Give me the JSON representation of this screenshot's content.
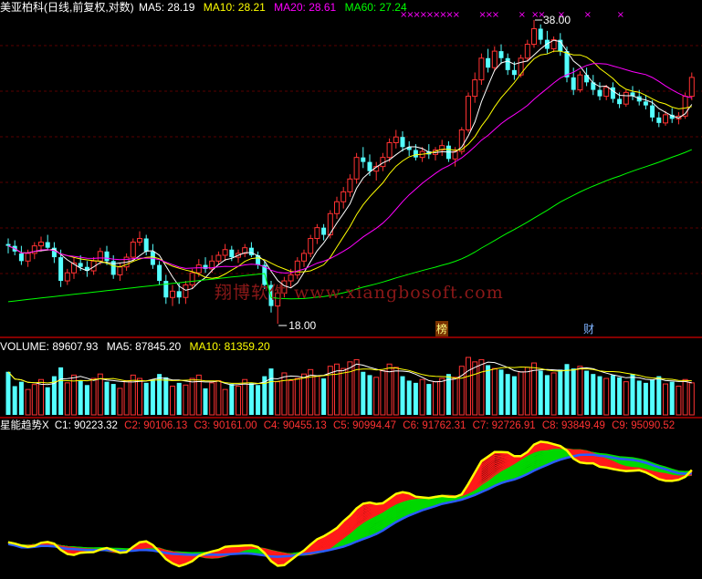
{
  "panel_price": {
    "stock_name": "美亚柏科",
    "mode": "(日线,前复权,对数)",
    "ma": [
      {
        "label": "MA5:",
        "value": "28.19",
        "color": "#ffffff"
      },
      {
        "label": "MA10:",
        "value": "28.21",
        "color": "#ffff00"
      },
      {
        "label": "MA20:",
        "value": "28.61",
        "color": "#ff00ff"
      },
      {
        "label": "MA60:",
        "value": "27.24",
        "color": "#00ff00"
      }
    ],
    "high_label": "38.00",
    "low_label": "18.00",
    "event_markers": [
      "榜",
      "财"
    ]
  },
  "panel_volume": {
    "label": "VOLUME:",
    "value": "89607.93",
    "ma5_label": "MA5:",
    "ma5": "87845.20",
    "ma10_label": "MA10:",
    "ma10": "81359.20"
  },
  "panel_indicator": {
    "name": "星能趋势X",
    "lines": [
      {
        "label": "C1:",
        "value": "90223.32"
      },
      {
        "label": "C2:",
        "value": "90106.13"
      },
      {
        "label": "C3:",
        "value": "90161.00"
      },
      {
        "label": "C4:",
        "value": "90455.13"
      },
      {
        "label": "C5:",
        "value": "90994.47"
      },
      {
        "label": "C6:",
        "value": "91762.31"
      },
      {
        "label": "C7:",
        "value": "92726.91"
      },
      {
        "label": "C8:",
        "value": "93849.49"
      },
      {
        "label": "C9:",
        "value": "95090.52"
      }
    ]
  },
  "watermark": "翔博软件 www.xiangbosoft.com",
  "colors": {
    "up": "#ff3232",
    "down": "#54ffff",
    "ma5": "#ffffff",
    "ma10": "#ffff00",
    "ma20": "#ff00ff",
    "ma60": "#00ff00",
    "sep": "#b00000"
  },
  "chart_data": [
    {
      "type": "candlestick",
      "title": "美亚柏科(日线,前复权,对数)",
      "scale": "log",
      "ylim": [
        18,
        38
      ],
      "ohlc": [
        [
          21.9,
          22.2,
          21.4,
          21.8
        ],
        [
          21.8,
          22.1,
          21.3,
          21.5
        ],
        [
          21.4,
          21.8,
          20.8,
          21.0
        ],
        [
          21.0,
          21.6,
          20.7,
          21.4
        ],
        [
          21.4,
          22.0,
          21.1,
          21.8
        ],
        [
          21.8,
          22.3,
          21.5,
          22.0
        ],
        [
          22.0,
          22.4,
          21.6,
          21.7
        ],
        [
          21.7,
          22.0,
          20.9,
          21.2
        ],
        [
          21.2,
          21.6,
          19.7,
          20.0
        ],
        [
          20.0,
          20.6,
          19.8,
          20.4
        ],
        [
          20.4,
          21.2,
          20.1,
          20.9
        ],
        [
          20.9,
          21.3,
          20.5,
          20.7
        ],
        [
          20.7,
          21.0,
          20.2,
          20.5
        ],
        [
          20.5,
          21.2,
          20.3,
          21.0
        ],
        [
          21.0,
          21.7,
          20.8,
          21.5
        ],
        [
          21.5,
          21.8,
          20.8,
          21.0
        ],
        [
          21.0,
          21.3,
          20.1,
          20.3
        ],
        [
          20.3,
          20.9,
          20.0,
          20.7
        ],
        [
          20.7,
          21.4,
          20.5,
          21.2
        ],
        [
          21.2,
          22.2,
          21.0,
          22.0
        ],
        [
          22.0,
          22.6,
          21.8,
          22.2
        ],
        [
          22.2,
          22.4,
          21.3,
          21.5
        ],
        [
          21.5,
          21.9,
          20.6,
          20.8
        ],
        [
          20.8,
          21.0,
          19.8,
          20.0
        ],
        [
          20.0,
          20.3,
          18.9,
          19.2
        ],
        [
          19.2,
          19.8,
          18.8,
          19.5
        ],
        [
          19.5,
          19.9,
          18.9,
          19.2
        ],
        [
          19.2,
          20.0,
          18.9,
          19.8
        ],
        [
          19.8,
          20.6,
          19.6,
          20.4
        ],
        [
          20.4,
          21.1,
          20.2,
          20.8
        ],
        [
          20.8,
          21.2,
          20.4,
          20.6
        ],
        [
          20.6,
          21.3,
          20.4,
          21.0
        ],
        [
          21.0,
          21.5,
          20.8,
          21.3
        ],
        [
          21.3,
          21.9,
          21.0,
          21.6
        ],
        [
          21.6,
          21.8,
          21.0,
          21.2
        ],
        [
          21.2,
          21.6,
          20.9,
          21.4
        ],
        [
          21.4,
          21.9,
          21.2,
          21.7
        ],
        [
          21.7,
          22.0,
          21.2,
          21.3
        ],
        [
          21.3,
          21.5,
          20.6,
          20.8
        ],
        [
          20.8,
          21.0,
          19.6,
          19.8
        ],
        [
          19.8,
          20.0,
          18.5,
          18.8
        ],
        [
          18.8,
          19.6,
          18.0,
          19.4
        ],
        [
          19.4,
          20.2,
          19.2,
          20.0
        ],
        [
          20.0,
          20.6,
          19.7,
          20.3
        ],
        [
          20.3,
          21.2,
          20.1,
          21.0
        ],
        [
          21.0,
          21.6,
          20.7,
          21.4
        ],
        [
          21.4,
          22.4,
          21.2,
          22.2
        ],
        [
          22.2,
          23.0,
          21.9,
          22.8
        ],
        [
          22.8,
          23.0,
          22.1,
          22.4
        ],
        [
          22.4,
          23.8,
          22.2,
          23.6
        ],
        [
          23.6,
          24.6,
          23.3,
          24.3
        ],
        [
          24.3,
          25.2,
          23.9,
          24.9
        ],
        [
          24.9,
          26.0,
          24.6,
          25.7
        ],
        [
          25.7,
          27.4,
          25.4,
          27.1
        ],
        [
          27.1,
          27.8,
          26.4,
          26.8
        ],
        [
          26.8,
          27.3,
          25.9,
          26.2
        ],
        [
          26.2,
          26.8,
          25.6,
          26.5
        ],
        [
          26.5,
          27.4,
          26.2,
          27.1
        ],
        [
          27.1,
          28.4,
          26.8,
          28.1
        ],
        [
          28.1,
          29.0,
          27.7,
          28.5
        ],
        [
          28.5,
          28.9,
          27.5,
          27.8
        ],
        [
          27.8,
          28.2,
          27.2,
          27.6
        ],
        [
          27.6,
          28.0,
          26.9,
          27.1
        ],
        [
          27.1,
          27.8,
          26.8,
          27.5
        ],
        [
          27.5,
          28.0,
          27.0,
          27.3
        ],
        [
          27.3,
          27.8,
          26.9,
          27.6
        ],
        [
          27.6,
          28.3,
          27.2,
          27.9
        ],
        [
          27.9,
          28.2,
          26.8,
          27.0
        ],
        [
          27.0,
          27.8,
          26.5,
          27.5
        ],
        [
          27.5,
          29.2,
          27.3,
          29.0
        ],
        [
          29.0,
          31.8,
          28.8,
          31.5
        ],
        [
          31.5,
          33.4,
          31.0,
          32.8
        ],
        [
          32.8,
          35.0,
          32.4,
          34.6
        ],
        [
          34.6,
          35.4,
          33.4,
          33.8
        ],
        [
          33.8,
          35.6,
          33.5,
          35.2
        ],
        [
          35.2,
          35.8,
          34.1,
          34.6
        ],
        [
          34.6,
          35.0,
          33.2,
          33.6
        ],
        [
          33.6,
          34.3,
          32.8,
          33.2
        ],
        [
          33.2,
          34.9,
          33.0,
          34.6
        ],
        [
          34.6,
          36.2,
          34.3,
          35.8
        ],
        [
          35.8,
          38.0,
          35.5,
          37.2
        ],
        [
          37.2,
          37.6,
          35.8,
          36.2
        ],
        [
          36.2,
          37.0,
          35.0,
          35.4
        ],
        [
          35.4,
          36.5,
          35.1,
          36.2
        ],
        [
          36.2,
          36.8,
          34.8,
          35.2
        ],
        [
          35.2,
          35.6,
          32.6,
          33.0
        ],
        [
          33.0,
          33.8,
          31.6,
          32.0
        ],
        [
          32.0,
          33.5,
          31.8,
          33.2
        ],
        [
          33.2,
          33.8,
          32.3,
          32.6
        ],
        [
          32.6,
          33.2,
          31.6,
          32.0
        ],
        [
          32.0,
          32.6,
          31.2,
          31.5
        ],
        [
          31.5,
          32.4,
          31.2,
          32.2
        ],
        [
          32.2,
          32.6,
          31.0,
          31.3
        ],
        [
          31.3,
          31.8,
          30.6,
          30.9
        ],
        [
          30.9,
          32.0,
          30.7,
          31.8
        ],
        [
          31.8,
          32.3,
          31.2,
          31.5
        ],
        [
          31.5,
          32.0,
          30.8,
          31.1
        ],
        [
          31.1,
          31.6,
          30.5,
          30.8
        ],
        [
          30.8,
          31.2,
          29.6,
          29.9
        ],
        [
          29.9,
          30.3,
          29.2,
          29.5
        ],
        [
          29.5,
          30.4,
          29.3,
          30.1
        ],
        [
          30.1,
          30.6,
          29.5,
          29.8
        ],
        [
          29.8,
          30.3,
          29.4,
          30.0
        ],
        [
          30.0,
          31.8,
          29.8,
          31.5
        ],
        [
          31.5,
          33.4,
          31.2,
          33.0
        ]
      ],
      "volume": [
        78,
        52,
        60,
        46,
        55,
        64,
        50,
        70,
        86,
        58,
        72,
        62,
        54,
        66,
        74,
        60,
        56,
        48,
        62,
        72,
        66,
        58,
        64,
        74,
        68,
        52,
        58,
        54,
        66,
        72,
        48,
        58,
        62,
        46,
        56,
        52,
        64,
        58,
        54,
        70,
        84,
        60,
        76,
        62,
        66,
        74,
        82,
        70,
        66,
        88,
        92,
        84,
        96,
        100,
        78,
        72,
        68,
        80,
        92,
        86,
        70,
        62,
        58,
        64,
        56,
        60,
        66,
        74,
        68,
        88,
        104,
        96,
        100,
        90,
        84,
        82,
        74,
        70,
        78,
        86,
        94,
        80,
        72,
        76,
        82,
        92,
        84,
        88,
        80,
        74,
        70,
        66,
        72,
        68,
        60,
        74,
        62,
        58,
        64,
        70,
        56,
        60,
        52,
        64,
        58
      ]
    }
  ]
}
